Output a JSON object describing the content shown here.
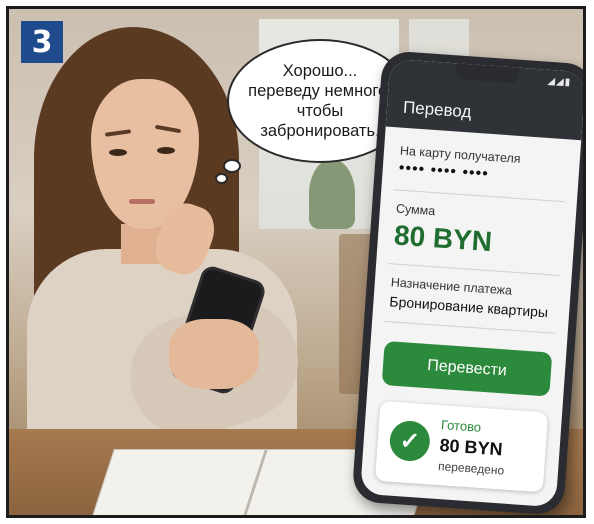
{
  "badge": {
    "number": "3"
  },
  "thought": {
    "line1": "Хорошо...",
    "line2": "переведу немного,",
    "line3": "чтобы",
    "line4": "забронировать."
  },
  "phone_screen": {
    "status_icons": "◢◢▮",
    "title": "Перевод",
    "recipient_label": "На карту получателя",
    "recipient_value": "•••• •••• ••••",
    "amount_label": "Сумма",
    "amount_value": "80 BYN",
    "purpose_label": "Назначение платежа",
    "purpose_value": "Бронирование квартиры",
    "transfer_button": "Перевести",
    "result": {
      "status": "Готово",
      "amount": "80 BYN",
      "note": "переведено",
      "icon": "check-icon"
    }
  },
  "colors": {
    "accent_green": "#2c8a3c",
    "badge_blue": "#1f4b8c",
    "header_dark": "#2f3338"
  }
}
